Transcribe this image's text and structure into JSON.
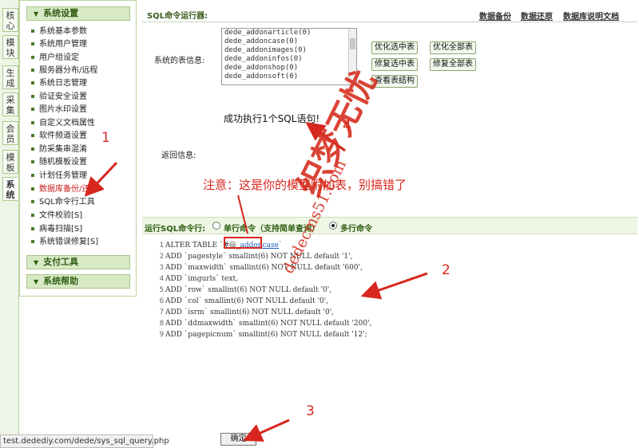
{
  "vertical_tabs": [
    "核心",
    "模块",
    "生成",
    "采集",
    "会员",
    "模板",
    "系统"
  ],
  "sidebar": {
    "section_system": "系统设置",
    "items": [
      "系统基本参数",
      "系统用户管理",
      "用户组设定",
      "服务器分布/远程",
      "系统日志管理",
      "验证安全设置",
      "图片水印设置",
      "自定义文档属性",
      "软件频道设置",
      "防采集串混淆",
      "随机模板设置",
      "计划任务管理",
      "数据库备份/还原",
      "SQL命令行工具",
      "文件校验[S]",
      "病毒扫描[S]",
      "系统错误修复[S]"
    ],
    "section_pay": "支付工具",
    "section_help": "系统帮助"
  },
  "main": {
    "title": "SQL命令运行器:",
    "links": [
      "数据备份",
      "数据还原",
      "数据库说明文档"
    ],
    "table_info_label": "系统的表信息:",
    "tables": [
      "dede_addonarticle(0)",
      "dede_addoncase(0)",
      "dede_addonimages(0)",
      "dede_addoninfos(0)",
      "dede_addonshop(0)",
      "dede_addonsoft(0)"
    ],
    "buttons": {
      "optimize_selected": "优化选中表",
      "optimize_all": "优化全部表",
      "repair_selected": "修复选中表",
      "repair_all": "修复全部表",
      "view_structure": "查看表结构"
    },
    "success_msg": "成功执行1个SQL语句!",
    "return_label": "返回信息:",
    "run_label": "运行SQL命令行:",
    "radio_single": "单行命令（支持简单查询）",
    "radio_multi": "多行命令",
    "code_lines": [
      {
        "n": "1",
        "pre": "ALTER TABLE `#@_",
        "hl": "addoncase",
        "post": "`"
      },
      {
        "n": "2",
        "text": "ADD `pagestyle` smallint(6) NOT NULL default '1',"
      },
      {
        "n": "3",
        "text": "ADD `maxwidth` smallint(6) NOT NULL default '600',"
      },
      {
        "n": "4",
        "text": "ADD `imgurls` text,"
      },
      {
        "n": "5",
        "text": "ADD `row` smallint(6) NOT NULL default '0',"
      },
      {
        "n": "6",
        "text": "ADD `col` smallint(6) NOT NULL default '0',"
      },
      {
        "n": "7",
        "text": "ADD `isrm` smallint(6) NOT NULL default '0',"
      },
      {
        "n": "8",
        "text": "ADD `ddmaxwidth` smallint(6) NOT NULL default '200',"
      },
      {
        "n": "9",
        "text": "ADD `pagepicnum` smallint(6) NOT NULL default '12';"
      }
    ],
    "ok_button": "确定"
  },
  "annotations": {
    "note": "注意：这是你的模型附加表，别搞错了",
    "n1": "1",
    "n2": "2",
    "n3": "3",
    "n4": "4",
    "watermark_big": "织梦无忧",
    "watermark_url": "dedecms51.com"
  },
  "status_bar": "test.dedediy.com/dede/sys_sql_query.php",
  "colors": {
    "annotation": "#d7261e",
    "accent_green": "#2f5d12"
  }
}
